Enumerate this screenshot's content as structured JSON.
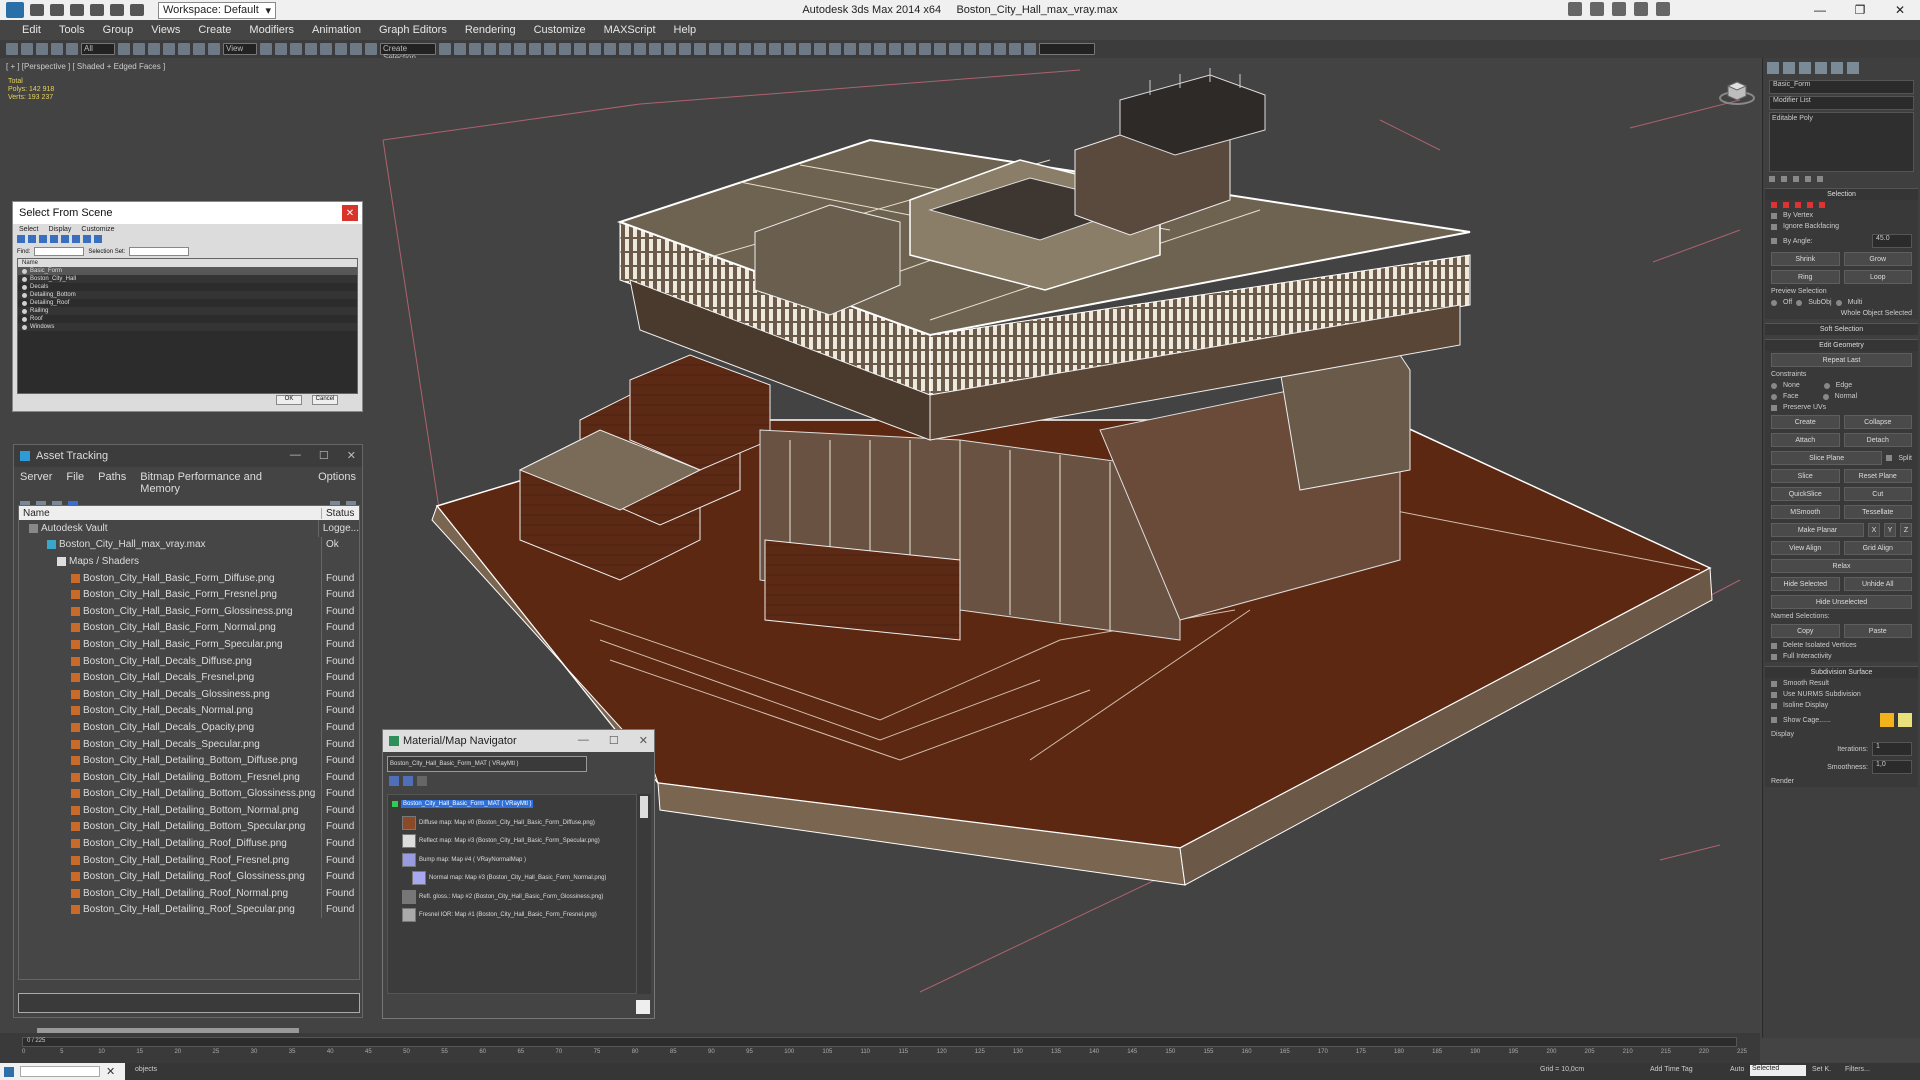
{
  "titlebar": {
    "workspace": "Workspace: Default",
    "app_title": "Autodesk 3ds Max  2014 x64",
    "file_title": "Boston_City_Hall_max_vray.max"
  },
  "menubar": {
    "items": [
      "Edit",
      "Tools",
      "Group",
      "Views",
      "Create",
      "Modifiers",
      "Animation",
      "Graph Editors",
      "Rendering",
      "Customize",
      "MAXScript",
      "Help"
    ]
  },
  "toolbar": {
    "selection_filter": "All",
    "ref_coord": "View",
    "named_sel": "Create Selection"
  },
  "viewport": {
    "label": "[ + ] [Perspective ] [ Shaded + Edged Faces ]",
    "stats": {
      "total": "Total",
      "polys": "Polys: 142 918",
      "verts": "Verts: 193 237"
    }
  },
  "select_scene": {
    "title": "Select From Scene",
    "menu": [
      "Select",
      "Display",
      "Customize"
    ],
    "find_label": "Find:",
    "selection_set": "Selection Set:",
    "name_header": "Name",
    "items": [
      "Basic_Form",
      "Boston_City_Hall",
      "Decals",
      "Detailing_Bottom",
      "Detailing_Roof",
      "Railing",
      "Roof",
      "Windows"
    ],
    "ok": "OK",
    "cancel": "Cancel"
  },
  "asset_tracking": {
    "title": "Asset Tracking",
    "menu": [
      "Server",
      "File",
      "Paths",
      "Bitmap Performance and Memory",
      "Options"
    ],
    "col_name": "Name",
    "col_status": "Status",
    "rows": [
      {
        "name": "Autodesk Vault",
        "status": "Logge..."
      },
      {
        "name": "Boston_City_Hall_max_vray.max",
        "status": "Ok"
      },
      {
        "name": "Maps / Shaders",
        "status": ""
      },
      {
        "name": "Boston_City_Hall_Basic_Form_Diffuse.png",
        "status": "Found"
      },
      {
        "name": "Boston_City_Hall_Basic_Form_Fresnel.png",
        "status": "Found"
      },
      {
        "name": "Boston_City_Hall_Basic_Form_Glossiness.png",
        "status": "Found"
      },
      {
        "name": "Boston_City_Hall_Basic_Form_Normal.png",
        "status": "Found"
      },
      {
        "name": "Boston_City_Hall_Basic_Form_Specular.png",
        "status": "Found"
      },
      {
        "name": "Boston_City_Hall_Decals_Diffuse.png",
        "status": "Found"
      },
      {
        "name": "Boston_City_Hall_Decals_Fresnel.png",
        "status": "Found"
      },
      {
        "name": "Boston_City_Hall_Decals_Glossiness.png",
        "status": "Found"
      },
      {
        "name": "Boston_City_Hall_Decals_Normal.png",
        "status": "Found"
      },
      {
        "name": "Boston_City_Hall_Decals_Opacity.png",
        "status": "Found"
      },
      {
        "name": "Boston_City_Hall_Decals_Specular.png",
        "status": "Found"
      },
      {
        "name": "Boston_City_Hall_Detailing_Bottom_Diffuse.png",
        "status": "Found"
      },
      {
        "name": "Boston_City_Hall_Detailing_Bottom_Fresnel.png",
        "status": "Found"
      },
      {
        "name": "Boston_City_Hall_Detailing_Bottom_Glossiness.png",
        "status": "Found"
      },
      {
        "name": "Boston_City_Hall_Detailing_Bottom_Normal.png",
        "status": "Found"
      },
      {
        "name": "Boston_City_Hall_Detailing_Bottom_Specular.png",
        "status": "Found"
      },
      {
        "name": "Boston_City_Hall_Detailing_Roof_Diffuse.png",
        "status": "Found"
      },
      {
        "name": "Boston_City_Hall_Detailing_Roof_Fresnel.png",
        "status": "Found"
      },
      {
        "name": "Boston_City_Hall_Detailing_Roof_Glossiness.png",
        "status": "Found"
      },
      {
        "name": "Boston_City_Hall_Detailing_Roof_Normal.png",
        "status": "Found"
      },
      {
        "name": "Boston_City_Hall_Detailing_Roof_Specular.png",
        "status": "Found"
      }
    ]
  },
  "material_navigator": {
    "title": "Material/Map Navigator",
    "field": "Boston_City_Hall_Basic_Form_MAT ( VRayMtl )",
    "nodes": [
      "Boston_City_Hall_Basic_Form_MAT ( VRayMtl )",
      "Diffuse map: Map #0 (Boston_City_Hall_Basic_Form_Diffuse.png)",
      "Reflect map: Map #3 (Boston_City_Hall_Basic_Form_Specular.png)",
      "Bump map: Map #4 ( VRayNormalMap )",
      "Normal map: Map #3 (Boston_City_Hall_Basic_Form_Normal.png)",
      "Refl. gloss.: Map #2 (Boston_City_Hall_Basic_Form_Glossiness.png)",
      "Fresnel IOR: Map #1 (Boston_City_Hall_Basic_Form_Fresnel.png)"
    ]
  },
  "command_panel": {
    "object_name": "Basic_Form",
    "modifier_list": "Modifier List",
    "stack_item": "Editable Poly",
    "selection_header": "Selection",
    "by_vertex": "By Vertex",
    "ignore_backfacing": "Ignore Backfacing",
    "by_angle": "By Angle:",
    "angle_val": "45.0",
    "shrink": "Shrink",
    "grow": "Grow",
    "ring": "Ring",
    "loop": "Loop",
    "preview_selection": "Preview Selection",
    "off": "Off",
    "subobj": "SubObj",
    "multi": "Multi",
    "whole_selected": "Whole Object Selected",
    "soft_selection": "Soft Selection",
    "edit_geometry": "Edit Geometry",
    "repeat_last": "Repeat Last",
    "constraints": "Constraints",
    "none": "None",
    "edge": "Edge",
    "face": "Face",
    "normal": "Normal",
    "preserve_uvs": "Preserve UVs",
    "create": "Create",
    "collapse": "Collapse",
    "attach": "Attach",
    "detach": "Detach",
    "slice_plane": "Slice Plane",
    "split": "Split",
    "slice": "Slice",
    "reset_plane": "Reset Plane",
    "quickslice": "QuickSlice",
    "cut": "Cut",
    "msmooth": "MSmooth",
    "tessellate": "Tessellate",
    "make_planar": "Make Planar",
    "x": "X",
    "y": "Y",
    "z": "Z",
    "view_align": "View Align",
    "grid_align": "Grid Align",
    "relax": "Relax",
    "hide_selected": "Hide Selected",
    "unhide_all": "Unhide All",
    "hide_unselected": "Hide Unselected",
    "named_selections": "Named Selections:",
    "copy": "Copy",
    "paste": "Paste",
    "delete_isolated": "Delete Isolated Vertices",
    "full_interactivity": "Full Interactivity",
    "subdivision_surface": "Subdivision Surface",
    "smooth_result": "Smooth Result",
    "use_nurms": "Use NURMS Subdivision",
    "isoline_display": "Isoline Display",
    "show_cage": "Show Cage......",
    "display": "Display",
    "iterations": "Iterations:",
    "iter_val": "1",
    "smoothness": "Smoothness:",
    "smooth_val": "1,0",
    "render": "Render",
    "swatch1": "#f2b21a",
    "swatch2": "#e8e07a"
  },
  "timeline": {
    "frame": "0 / 225",
    "ticks": [
      "0",
      "5",
      "10",
      "15",
      "20",
      "25",
      "30",
      "35",
      "40",
      "45",
      "50",
      "55",
      "60",
      "65",
      "70",
      "75",
      "80",
      "85",
      "90",
      "95",
      "100",
      "105",
      "110",
      "115",
      "120",
      "125",
      "130",
      "135",
      "140",
      "145",
      "150",
      "155",
      "160",
      "165",
      "170",
      "175",
      "180",
      "185",
      "190",
      "195",
      "200",
      "205",
      "210",
      "215",
      "220",
      "225"
    ]
  },
  "status": {
    "objects": "objects",
    "grid": "Grid = 10,0cm",
    "auto": "Auto",
    "selected": "Selected",
    "set_key": "Set K.",
    "filters": "Filters...",
    "add_time_tag": "Add Time Tag"
  }
}
